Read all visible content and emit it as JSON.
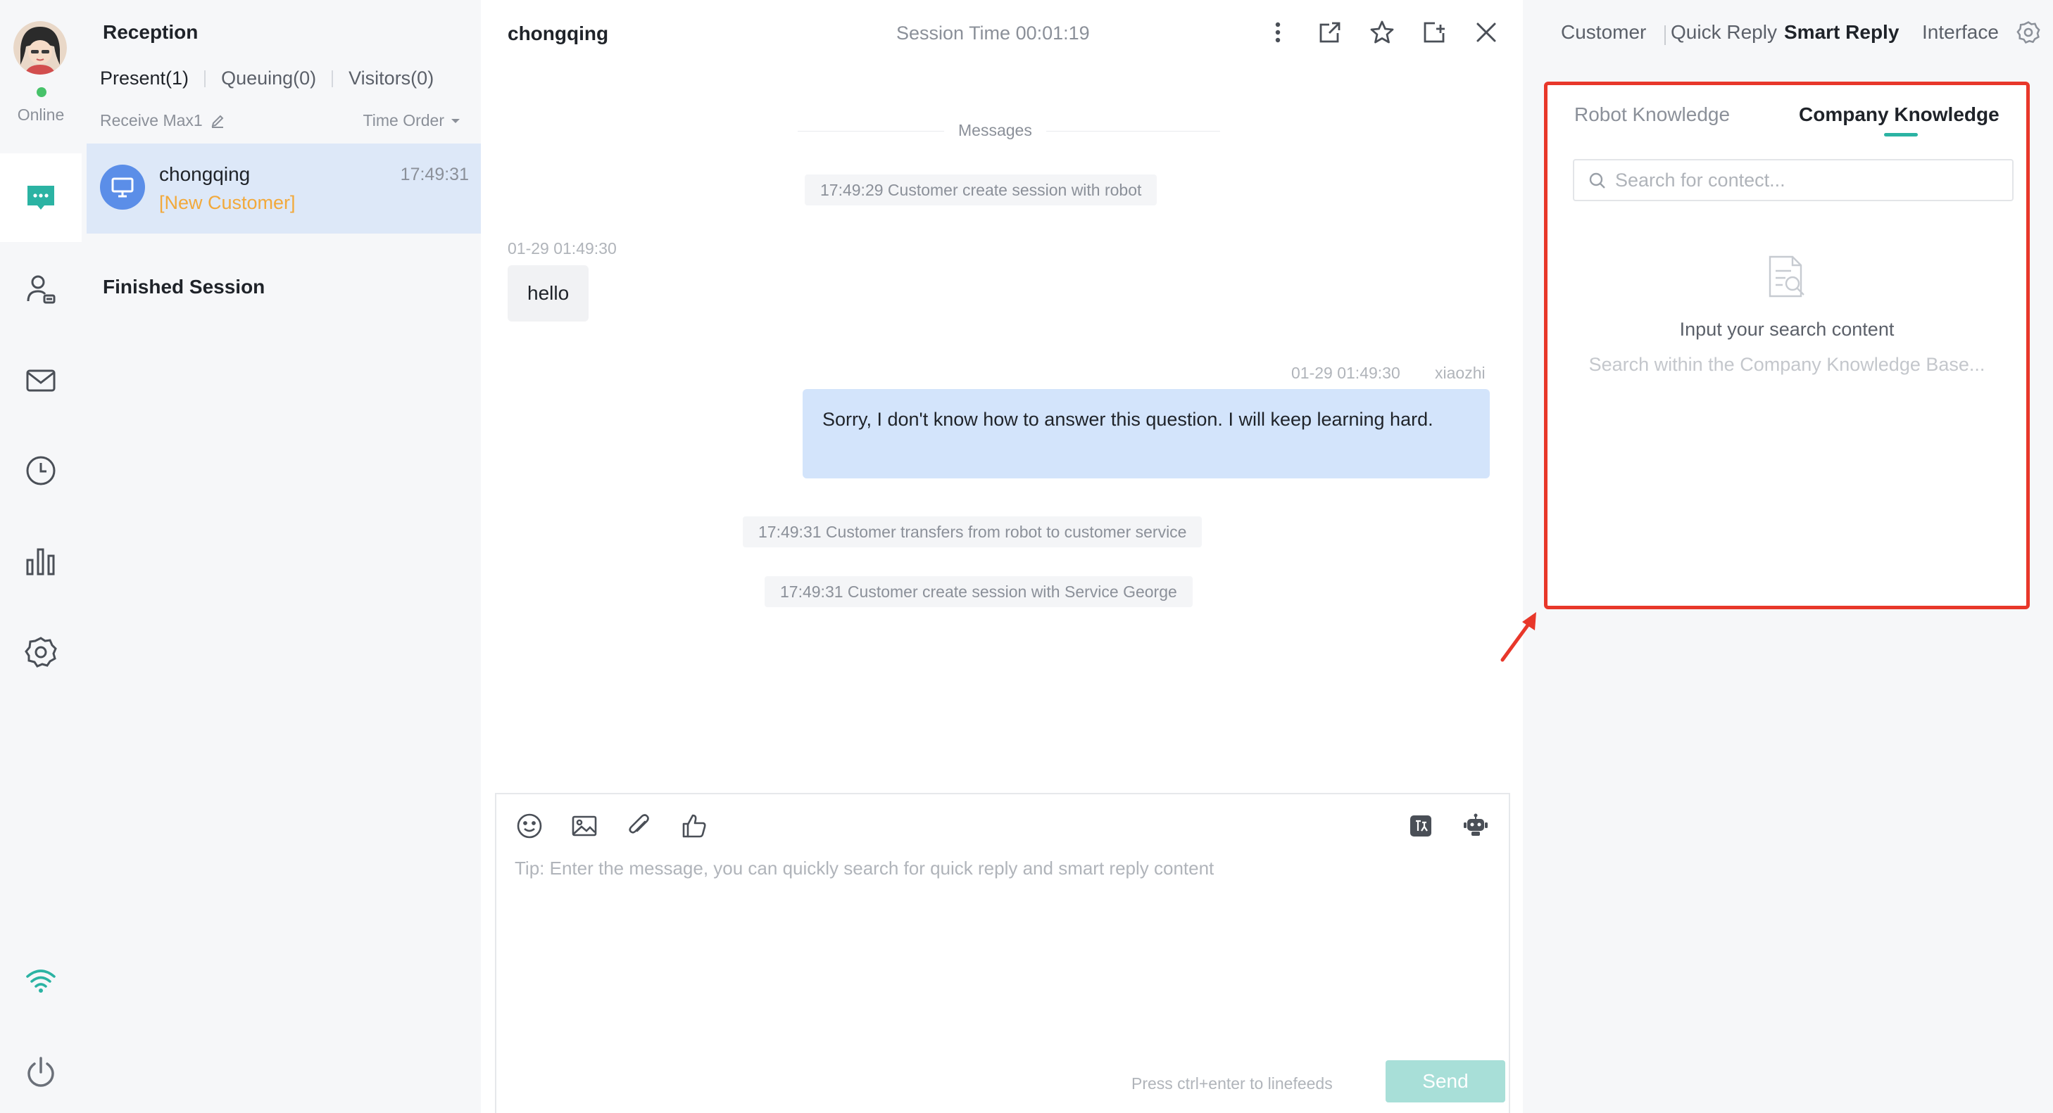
{
  "app": {
    "status": "Online",
    "accent_color": "#2bb3a3",
    "highlight_color": "#e8372a"
  },
  "rail": {
    "items": [
      {
        "icon": "chat-bubble-icon",
        "active": true
      },
      {
        "icon": "customer-icon",
        "active": false
      },
      {
        "icon": "mail-icon",
        "active": false
      },
      {
        "icon": "history-clock-icon",
        "active": false
      },
      {
        "icon": "bar-chart-icon",
        "active": false
      },
      {
        "icon": "gear-icon",
        "active": false
      }
    ],
    "bottom": [
      {
        "icon": "wifi-icon"
      },
      {
        "icon": "power-icon"
      }
    ]
  },
  "list": {
    "title": "Reception",
    "tabs": [
      {
        "label": "Present(1)",
        "active": true
      },
      {
        "label": "Queuing(0)",
        "active": false
      },
      {
        "label": "Visitors(0)",
        "active": false
      }
    ],
    "receive_label": "Receive Max1",
    "order_label": "Time Order",
    "sessions": [
      {
        "name": "chongqing",
        "tag": "[New Customer]",
        "time": "17:49:31"
      }
    ],
    "finished_label": "Finished Session"
  },
  "chat": {
    "title": "chongqing",
    "session_time": "Session Time 00:01:19",
    "divider": "Messages",
    "system_messages": [
      "17:49:29 Customer create session with robot",
      "17:49:31 Customer transfers from robot to customer service",
      "17:49:31 Customer create session with Service George"
    ],
    "incoming": {
      "time": "01-29 01:49:30",
      "text": "hello"
    },
    "outgoing": {
      "time": "01-29 01:49:30",
      "sender": "xiaozhi",
      "text": "Sorry, I don't know how to answer this question. I will keep learning hard."
    },
    "composer": {
      "placeholder": "Tip: Enter the message, you can quickly search for quick reply and smart reply content",
      "hint": "Press ctrl+enter to linefeeds",
      "send_label": "Send"
    }
  },
  "right_panel": {
    "tabs": [
      {
        "label": "Customer",
        "active": false
      },
      {
        "label": "Quick Reply",
        "active": false
      },
      {
        "label": "Smart Reply",
        "active": true
      },
      {
        "label": "Interface",
        "active": false
      }
    ],
    "knowledge_tabs": [
      {
        "label": "Robot Knowledge",
        "active": false
      },
      {
        "label": "Company Knowledge",
        "active": true
      }
    ],
    "search_placeholder": "Search for contect...",
    "empty_title": "Input your search content",
    "empty_subtitle": "Search within the Company Knowledge Base..."
  }
}
